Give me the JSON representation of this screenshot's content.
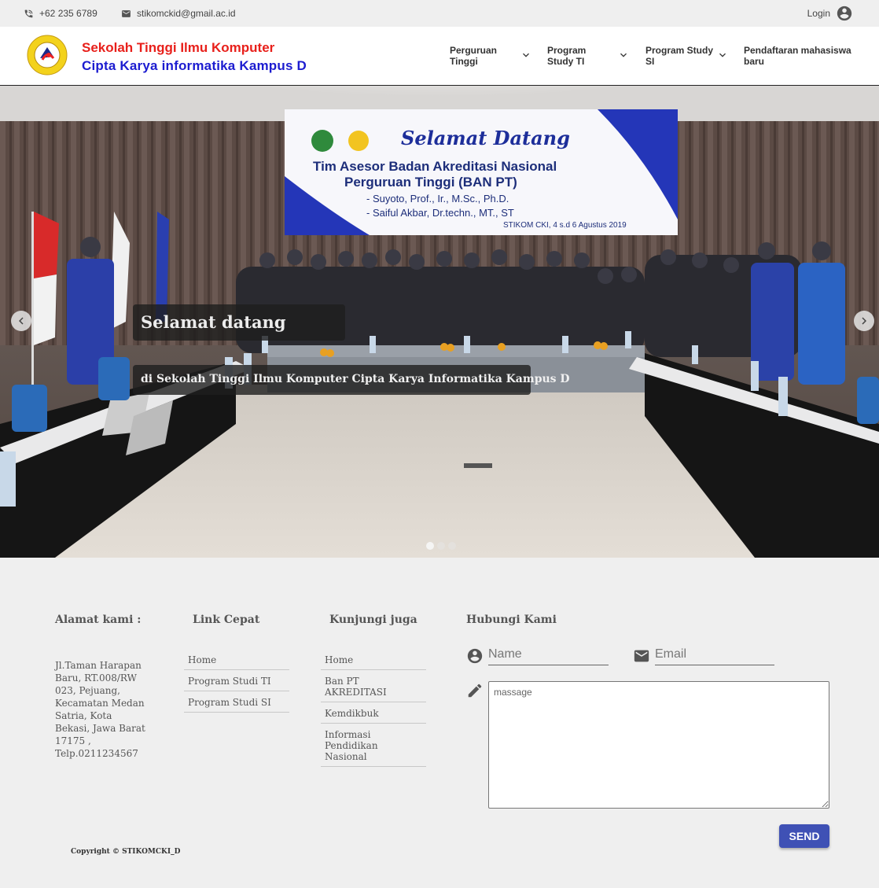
{
  "topbar": {
    "phone": "+62 235 6789",
    "email": "stikomckid@gmail.ac.id",
    "login_label": "Login",
    "icons": [
      "phone-icon",
      "mail-icon",
      "account-circle-icon"
    ]
  },
  "header": {
    "title_line1": "Sekolah Tinggi Ilmu Komputer",
    "title_line2": "Cipta Karya informatika Kampus D",
    "title_color1": "#e8201b",
    "title_color2": "#1c1cd0",
    "nav": [
      {
        "label_l1": "Perguruan",
        "label_l2": "Tinggi"
      },
      {
        "label_l1": "Program",
        "label_l2": "Study TI"
      },
      {
        "label_l1": "Program Study",
        "label_l2": "SI"
      },
      {
        "label_l1": "Pendaftaran mahasiswa",
        "label_l2": "baru"
      }
    ]
  },
  "hero": {
    "caption_title": "Selamat datang",
    "caption_text": "di Sekolah Tinggi Ilmu Komputer Cipta Karya Informatika Kampus D",
    "banner": {
      "welcome": "Selamat Datang",
      "line1": "Tim Asesor Badan Akreditasi Nasional",
      "line2": "Perguruan Tinggi (BAN PT)",
      "line3": "- Suyoto, Prof., Ir., M.Sc., Ph.D.",
      "line4": "- Saiful Akbar, Dr.techn., MT., ST",
      "line5": "STIKOM CKI, 4 s.d 6 Agustus 2019"
    },
    "slide_count": 3,
    "active_slide": 1
  },
  "footer": {
    "address_title": "Alamat kami :",
    "address": "Jl.Taman Harapan Baru, RT.008/RW 023, Pejuang, Kecamatan Medan Satria, Kota Bekasi, Jawa Barat 17175 , Telp.0211234567",
    "quick_title": "Link Cepat",
    "quick_links": [
      "Home",
      "Program Studi TI",
      "Program Studi SI"
    ],
    "visit_title": "Kunjungi juga",
    "visit_links": [
      "Home",
      "Ban PT AKREDITASI",
      "Kemdikbuk",
      "Informasi Pendidikan Nasional"
    ],
    "contact_title": "Hubungi Kami",
    "name_placeholder": "Name",
    "email_placeholder": "Email",
    "message_placeholder": "massage",
    "send_label": "SEND",
    "copyright": "Copyright © STIKOMCKI_D"
  },
  "colors": {
    "send_button": "#3f51b5",
    "background": "#efefef"
  }
}
